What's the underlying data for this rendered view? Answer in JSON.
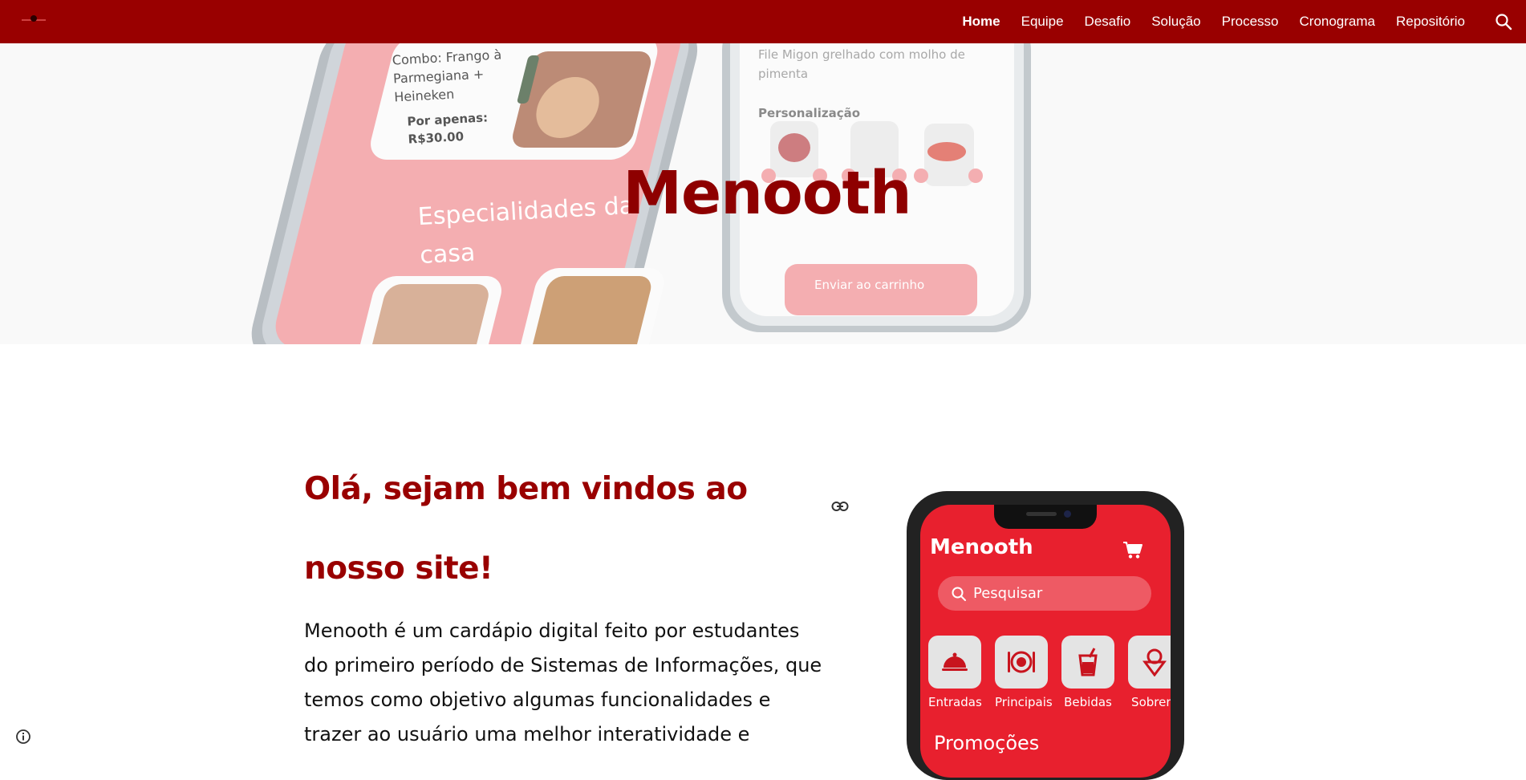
{
  "nav": {
    "items": [
      {
        "label": "Home",
        "active": true
      },
      {
        "label": "Equipe",
        "active": false
      },
      {
        "label": "Desafio",
        "active": false
      },
      {
        "label": "Solução",
        "active": false
      },
      {
        "label": "Processo",
        "active": false
      },
      {
        "label": "Cronograma",
        "active": false
      },
      {
        "label": "Repositório",
        "active": false
      }
    ],
    "search_icon": "search-icon"
  },
  "hero": {
    "title": "Menooth",
    "phone_left": {
      "combo": [
        "Combo: Frango à",
        "Parmegiana +",
        "Heineken"
      ],
      "price_label": "Por apenas:",
      "price": "R$30.00",
      "section": [
        "Especialidades da",
        "casa"
      ]
    },
    "phone_right": {
      "description": [
        "File Migon grelhado com molho de",
        "pimenta"
      ],
      "personalization": "Personalização",
      "cart_button": "Enviar ao carrinho"
    }
  },
  "intro": {
    "heading": [
      "Olá, sejam bem vindos ao",
      "nosso site!"
    ],
    "body": [
      "Menooth é um cardápio digital feito por estudantes",
      "do primeiro período de Sistemas de Informações, que",
      "temos como objetivo algumas funcionalidades e",
      "trazer ao usuário uma melhor interatividade e"
    ]
  },
  "app_mockup": {
    "title": "Menooth",
    "search_placeholder": "Pesquisar",
    "categories": [
      "Entradas",
      "Principais",
      "Bebidas",
      "Sobrem"
    ],
    "promotions": "Promoções"
  },
  "colors": {
    "brand": "#990000",
    "heading": "#990000",
    "app_red": "#e8202e"
  }
}
